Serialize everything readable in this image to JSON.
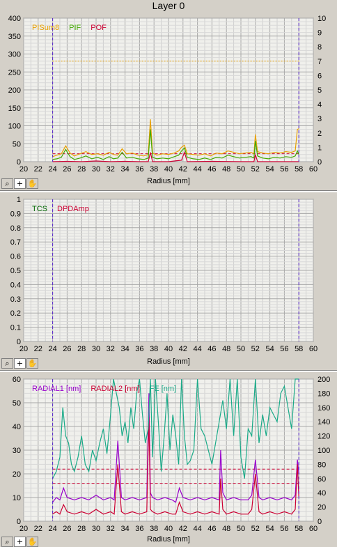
{
  "window": {
    "title": "Layer 0"
  },
  "toolbar": {
    "zoom_icon": "⌕",
    "crosshair_icon": "+",
    "pan_icon": "✋"
  },
  "chart_data": [
    {
      "type": "line",
      "xlabel": "Radius [mm]",
      "xlim": [
        20,
        60
      ],
      "xticks": [
        20,
        22,
        24,
        26,
        28,
        30,
        32,
        34,
        36,
        38,
        40,
        42,
        44,
        46,
        48,
        50,
        52,
        54,
        56,
        58,
        60
      ],
      "ylim": [
        0,
        400
      ],
      "yticks": [
        0,
        50,
        100,
        150,
        200,
        250,
        300,
        350,
        400
      ],
      "y2lim": [
        0,
        10
      ],
      "y2ticks": [
        0,
        1,
        2,
        3,
        4,
        5,
        6,
        7,
        8,
        9,
        10
      ],
      "grid": true,
      "vlines": [
        24,
        58
      ],
      "legend_position": "top-left",
      "hlines": [
        {
          "axis": "y2",
          "value": 7.0,
          "color": "#e8a000",
          "style": "dotted"
        },
        {
          "axis": "y2",
          "value": 0.55,
          "color": "#cc0033",
          "style": "dashed"
        }
      ],
      "series": [
        {
          "name": "PISum8",
          "axis": "y",
          "color": "#e8a000",
          "x": [
            24,
            24.6,
            25.2,
            25.8,
            26.4,
            27,
            27.8,
            28.6,
            29.4,
            30.2,
            31,
            31.8,
            32.4,
            33,
            33.6,
            34.2,
            35,
            35.8,
            36.6,
            37.2,
            37.5,
            37.8,
            38.4,
            39.2,
            40,
            40.8,
            41.4,
            41.8,
            42.2,
            42.6,
            43.4,
            44.2,
            45,
            45.8,
            46.6,
            47.4,
            48.2,
            49,
            49.8,
            50.6,
            51.4,
            51.8,
            52,
            52.3,
            53,
            53.8,
            54.6,
            55.4,
            56.2,
            57,
            57.5,
            57.8,
            58
          ],
          "values": [
            14,
            18,
            22,
            44,
            24,
            16,
            22,
            28,
            20,
            22,
            18,
            26,
            20,
            18,
            36,
            22,
            24,
            18,
            16,
            20,
            118,
            24,
            18,
            22,
            20,
            24,
            30,
            40,
            46,
            22,
            20,
            18,
            22,
            16,
            24,
            22,
            30,
            26,
            22,
            24,
            26,
            22,
            76,
            28,
            24,
            22,
            26,
            24,
            28,
            26,
            30,
            90,
            92
          ]
        },
        {
          "name": "PIF",
          "axis": "y",
          "color": "#44aa00",
          "x": [
            24,
            24.6,
            25.2,
            25.8,
            26.4,
            27,
            27.8,
            28.6,
            29.4,
            30.2,
            31,
            31.8,
            32.4,
            33,
            33.6,
            34.2,
            35,
            35.8,
            36.6,
            37.2,
            37.5,
            37.8,
            38.4,
            39.2,
            40,
            40.8,
            41.4,
            41.8,
            42.2,
            42.6,
            43.4,
            44.2,
            45,
            45.8,
            46.6,
            47.4,
            48.2,
            49,
            49.8,
            50.6,
            51.4,
            51.8,
            52,
            52.3,
            53,
            53.8,
            54.6,
            55.4,
            56.2,
            57,
            57.5,
            57.8,
            58
          ],
          "values": [
            6,
            8,
            12,
            34,
            14,
            6,
            10,
            16,
            8,
            12,
            6,
            14,
            8,
            10,
            26,
            10,
            12,
            8,
            6,
            10,
            90,
            12,
            8,
            10,
            8,
            14,
            18,
            30,
            38,
            12,
            8,
            6,
            10,
            6,
            12,
            10,
            18,
            14,
            10,
            12,
            14,
            10,
            58,
            16,
            10,
            8,
            12,
            10,
            14,
            12,
            16,
            30,
            20
          ]
        },
        {
          "name": "POF",
          "axis": "y",
          "color": "#cc0033",
          "x": [
            24,
            26,
            28,
            30,
            32,
            34,
            36,
            37.2,
            37.5,
            37.8,
            40,
            41.8,
            42.2,
            42.6,
            46,
            50,
            51.8,
            52,
            52.3,
            56,
            58
          ],
          "values": [
            0,
            1,
            0,
            2,
            0,
            1,
            0,
            0,
            26,
            0,
            0,
            4,
            26,
            0,
            1,
            0,
            0,
            20,
            0,
            0,
            0
          ]
        }
      ]
    },
    {
      "type": "line",
      "xlabel": "Radius [mm]",
      "xlim": [
        20,
        60
      ],
      "xticks": [
        20,
        22,
        24,
        26,
        28,
        30,
        32,
        34,
        36,
        38,
        40,
        42,
        44,
        46,
        48,
        50,
        52,
        54,
        56,
        58,
        60
      ],
      "ylim": [
        0,
        1
      ],
      "yticks": [
        0,
        0.1,
        0.2,
        0.3,
        0.4,
        0.5,
        0.6,
        0.7,
        0.8,
        0.9,
        1
      ],
      "grid": true,
      "vlines": [
        24,
        58
      ],
      "legend_position": "top-left",
      "series": [
        {
          "name": "TCS",
          "axis": "y",
          "color": "#006600",
          "x": [],
          "values": []
        },
        {
          "name": "DPDAmp",
          "axis": "y",
          "color": "#cc0033",
          "x": [],
          "values": []
        }
      ]
    },
    {
      "type": "line",
      "xlabel": "Radius [mm]",
      "xlim": [
        20,
        60
      ],
      "xticks": [
        20,
        22,
        24,
        26,
        28,
        30,
        32,
        34,
        36,
        38,
        40,
        42,
        44,
        46,
        48,
        50,
        52,
        54,
        56,
        58,
        60
      ],
      "ylim": [
        0,
        60
      ],
      "yticks": [
        0,
        10,
        20,
        30,
        40,
        50,
        60
      ],
      "y2lim": [
        0,
        200
      ],
      "y2ticks": [
        0,
        20,
        40,
        60,
        80,
        100,
        120,
        140,
        160,
        180,
        200
      ],
      "grid": true,
      "vlines": [
        24,
        58
      ],
      "legend_position": "top-left",
      "hlines": [
        {
          "axis": "y",
          "value": 16,
          "color": "#cc0033",
          "style": "dashed"
        },
        {
          "axis": "y",
          "value": 22,
          "color": "#cc0033",
          "style": "dashed"
        }
      ],
      "series": [
        {
          "name": "RADIAL1 [nm]",
          "axis": "y",
          "color": "#9900cc",
          "x": [
            24,
            24.5,
            25,
            25.5,
            26,
            27,
            28,
            29,
            30,
            31,
            32,
            32.5,
            33,
            33.5,
            34,
            35,
            36,
            37,
            37.3,
            37.5,
            37.8,
            38.5,
            39.5,
            40.5,
            41,
            41.5,
            42,
            43,
            44,
            45,
            46,
            47,
            47.2,
            47.5,
            48,
            49,
            50,
            51,
            51.5,
            52,
            52.5,
            53,
            54,
            55,
            56,
            57,
            57.5,
            57.8,
            58
          ],
          "values": [
            8,
            10,
            9,
            14,
            10,
            9,
            10,
            9,
            11,
            9,
            10,
            9,
            34,
            10,
            9,
            10,
            9,
            10,
            54,
            12,
            10,
            9,
            10,
            9,
            8,
            14,
            10,
            9,
            10,
            9,
            10,
            9,
            30,
            12,
            9,
            10,
            9,
            9,
            11,
            26,
            10,
            9,
            10,
            9,
            10,
            9,
            11,
            26,
            20
          ]
        },
        {
          "name": "RADIAL2 [nm]",
          "axis": "y",
          "color": "#cc0033",
          "x": [
            24,
            24.5,
            25,
            25.5,
            26,
            27,
            28,
            29,
            30,
            31,
            32,
            32.5,
            33,
            33.5,
            34,
            35,
            36,
            37,
            37.3,
            37.5,
            37.8,
            38.5,
            39.5,
            40.5,
            41,
            41.5,
            42,
            43,
            44,
            45,
            46,
            47,
            47.2,
            47.5,
            48,
            49,
            50,
            51,
            51.5,
            52,
            52.5,
            53,
            54,
            55,
            56,
            57,
            57.5,
            57.8,
            58
          ],
          "values": [
            3,
            4,
            3,
            7,
            4,
            3,
            4,
            3,
            5,
            3,
            4,
            3,
            24,
            4,
            3,
            4,
            3,
            4,
            44,
            5,
            4,
            3,
            4,
            3,
            3,
            8,
            4,
            3,
            4,
            3,
            4,
            3,
            18,
            5,
            3,
            4,
            3,
            3,
            5,
            20,
            4,
            3,
            4,
            3,
            4,
            3,
            5,
            24,
            10
          ]
        },
        {
          "name": "FE [nm]",
          "axis": "y2",
          "color": "#1aaa88",
          "x": [
            24,
            24.5,
            25,
            25.4,
            25.8,
            26.2,
            26.6,
            27,
            27.5,
            28,
            28.5,
            29,
            29.5,
            30,
            30.5,
            31,
            31.5,
            32,
            32.4,
            32.8,
            33.2,
            33.6,
            34,
            34.4,
            34.8,
            35.2,
            35.6,
            36,
            36.4,
            36.8,
            37.2,
            37.5,
            37.8,
            38.2,
            38.6,
            39,
            39.4,
            39.8,
            40.2,
            40.6,
            41,
            41.4,
            41.8,
            42.2,
            42.6,
            43,
            43.5,
            44,
            44.5,
            45,
            45.5,
            46,
            46.5,
            47,
            47.5,
            48,
            48.5,
            49,
            49.5,
            50,
            50.5,
            51,
            51.5,
            52,
            52.5,
            53,
            53.5,
            54,
            54.5,
            55,
            55.5,
            56,
            56.5,
            57,
            57.5,
            58
          ],
          "values": [
            60,
            70,
            90,
            160,
            120,
            110,
            80,
            70,
            90,
            120,
            80,
            70,
            100,
            85,
            110,
            130,
            95,
            150,
            200,
            180,
            160,
            120,
            140,
            110,
            160,
            130,
            180,
            200,
            150,
            110,
            130,
            200,
            90,
            200,
            140,
            70,
            120,
            180,
            100,
            150,
            120,
            80,
            200,
            120,
            80,
            85,
            100,
            200,
            130,
            120,
            100,
            80,
            110,
            140,
            170,
            130,
            200,
            120,
            200,
            90,
            60,
            130,
            120,
            200,
            110,
            150,
            120,
            160,
            150,
            140,
            180,
            190,
            160,
            130,
            200,
            200
          ]
        }
      ]
    }
  ]
}
